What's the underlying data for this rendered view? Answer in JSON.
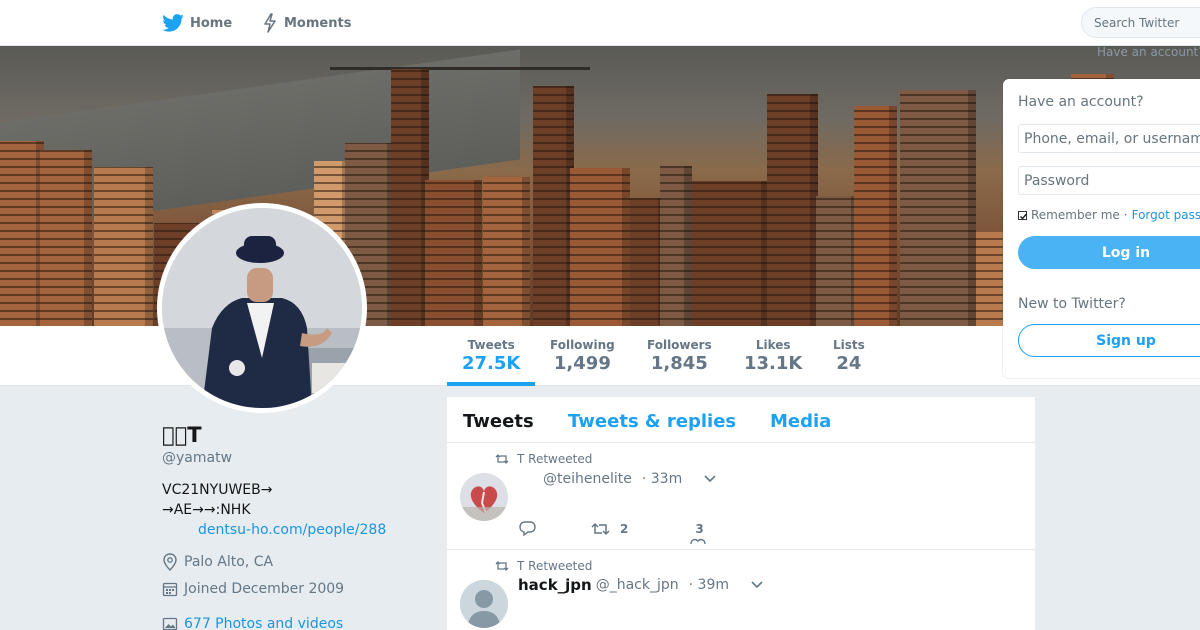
{
  "nav": {
    "home_label": "Home",
    "moments_label": "Moments",
    "search_placeholder": "Search Twitter",
    "have_account_hint": "Have an account?"
  },
  "colors": {
    "accent": "#1da1f2",
    "link": "#1b95e0",
    "login_button": "#4ab3f4",
    "page_bg": "#e6ecf0"
  },
  "profile": {
    "name": "\u0000\u0000T",
    "handle": "@yamatw",
    "bio_line1": "VC21NYUWEB→",
    "bio_line2": "→AE→→:NHK",
    "link": "dentsu-ho.com/people/288",
    "location": "Palo Alto, CA",
    "joined": "Joined December 2009",
    "photos_videos": "677 Photos and videos"
  },
  "stats": [
    {
      "label": "Tweets",
      "value": "27.5K"
    },
    {
      "label": "Following",
      "value": "1,499"
    },
    {
      "label": "Followers",
      "value": "1,845"
    },
    {
      "label": "Likes",
      "value": "13.1K"
    },
    {
      "label": "Lists",
      "value": "24"
    }
  ],
  "tabs": [
    "Tweets",
    "Tweets & replies",
    "Media"
  ],
  "tweets": [
    {
      "retweeted_by": "T Retweeted",
      "name": "",
      "handle": "@teihenelite",
      "time": "· 33m",
      "retweets": "2",
      "likes": "3",
      "avatar": "heart-photo"
    },
    {
      "retweeted_by": "T Retweeted",
      "name": "hack_jpn",
      "handle": "@_hack_jpn",
      "time": "· 39m",
      "avatar": "default-silhouette"
    }
  ],
  "login": {
    "heading": "Have an account?",
    "username_placeholder": "Phone, email, or username",
    "password_placeholder": "Password",
    "remember_label": "Remember me",
    "separator": "·",
    "forgot_label": "Forgot password?",
    "login_button": "Log in",
    "new_heading": "New to Twitter?",
    "signup_button": "Sign up"
  }
}
